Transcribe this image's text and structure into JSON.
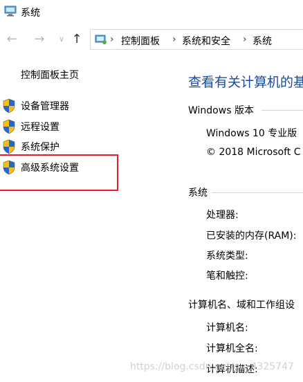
{
  "window": {
    "title": "系统",
    "app_icon": "system-computer-icon"
  },
  "nav": {
    "back_icon": "back-arrow-icon",
    "forward_icon": "forward-arrow-icon",
    "recent_icon": "chevron-down-icon",
    "up_icon": "up-arrow-icon",
    "address_icon": "control-panel-icon",
    "breadcrumb": [
      "控制面板",
      "系统和安全",
      "系统"
    ],
    "separator": "›"
  },
  "sidebar": {
    "home_link": "控制面板主页",
    "items": [
      {
        "label": "设备管理器",
        "icon": "uac-shield-icon"
      },
      {
        "label": "远程设置",
        "icon": "uac-shield-icon"
      },
      {
        "label": "系统保护",
        "icon": "uac-shield-icon"
      },
      {
        "label": "高级系统设置",
        "icon": "uac-shield-icon"
      }
    ],
    "highlight_color": "#e81c2a"
  },
  "main": {
    "title": "查看有关计算机的基",
    "windows_edition": {
      "header": "Windows 版本",
      "edition": "Windows 10 专业版",
      "copyright": "© 2018 Microsoft C"
    },
    "system": {
      "header": "系统",
      "rows": [
        "处理器:",
        "已安装的内存(RAM):",
        "系统类型:",
        "笔和触控:"
      ]
    },
    "computer_name": {
      "header": "计算机名、域和工作组设",
      "rows": [
        "计算机名:",
        "计算机全名:",
        "计算机描述:"
      ]
    }
  },
  "watermark": "https://blog.csdn.net/qq_4325747",
  "colors": {
    "title_blue": "#1a4b9b",
    "link_black": "#000000",
    "rule_gray": "#d6d6d6"
  }
}
